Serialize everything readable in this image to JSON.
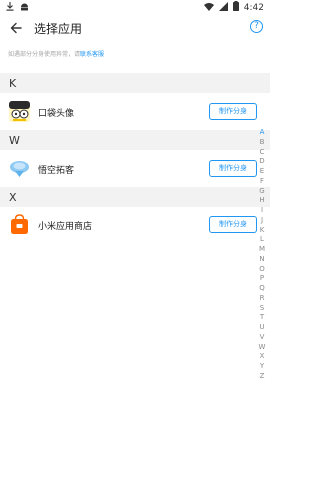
{
  "status_bar": {
    "time": "4:42",
    "left_icons": [
      "download-icon",
      "android-icon"
    ],
    "right_icons": [
      "wifi-icon",
      "signal-icon",
      "battery-icon"
    ]
  },
  "app_bar": {
    "title": "选择应用",
    "back_icon": "arrow-left-icon",
    "help_label": "?"
  },
  "notice": {
    "text": "如遇部分分身使用异常，请",
    "link_label": "联系客服"
  },
  "sections": [
    {
      "letter": "K",
      "apps": [
        {
          "name": "口袋头像",
          "button": "制作分身"
        }
      ]
    },
    {
      "letter": "W",
      "apps": [
        {
          "name": "悟空拓客",
          "button": "制作分身"
        }
      ]
    },
    {
      "letter": "X",
      "apps": [
        {
          "name": "小米应用商店",
          "button": "制作分身"
        }
      ]
    }
  ],
  "index_bar": {
    "letters": [
      "A",
      "B",
      "C",
      "D",
      "E",
      "F",
      "G",
      "H",
      "I",
      "J",
      "K",
      "L",
      "M",
      "N",
      "O",
      "P",
      "Q",
      "R",
      "S",
      "T",
      "U",
      "V",
      "W",
      "X",
      "Y",
      "Z"
    ],
    "active": "A"
  },
  "colors": {
    "accent": "#2196f3",
    "section_bg": "#f2f2f2",
    "text_primary": "#212121",
    "hint": "#a7a7a7",
    "mi_orange": "#ff6900"
  }
}
